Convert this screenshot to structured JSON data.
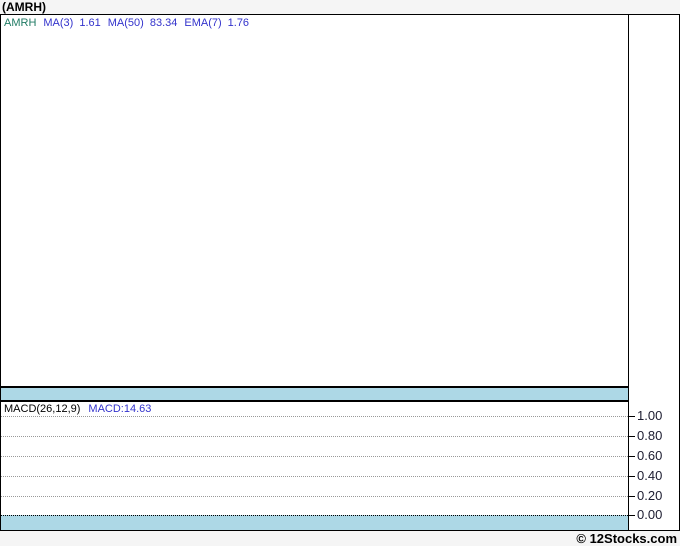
{
  "page": {
    "title": "(AMRH)",
    "copyright": "© 12Stocks.com"
  },
  "indicators": {
    "symbol": "AMRH",
    "items": [
      {
        "label": "MA(3)",
        "value": "1.61"
      },
      {
        "label": "MA(50)",
        "value": "83.34"
      },
      {
        "label": "EMA(7)",
        "value": "1.76"
      }
    ]
  },
  "macd": {
    "label": "MACD(26,12,9)",
    "value": "MACD:14.63",
    "axis_ticks": [
      "1.00",
      "0.80",
      "0.60",
      "0.40",
      "0.20",
      "0.00"
    ]
  },
  "colors": {
    "symbol": "#1f7a63",
    "blue": "#3333cc",
    "band": "#add8e6",
    "grid": "#999999",
    "axis_text": "#1c1c30"
  },
  "chart_data": {
    "type": "line",
    "title": "(AMRH)",
    "panels": [
      {
        "name": "price",
        "legend": [
          "AMRH",
          "MA(3) 1.61",
          "MA(50) 83.34",
          "EMA(7) 1.76"
        ],
        "legend_position": "top-left",
        "grid": false,
        "series": [],
        "note": "price panel rendered empty - no visible data points"
      },
      {
        "name": "MACD",
        "legend": [
          "MACD(26,12,9)",
          "MACD:14.63"
        ],
        "legend_position": "top-left",
        "ylim": [
          0.0,
          1.0
        ],
        "yticks": [
          1.0,
          0.8,
          0.6,
          0.4,
          0.2,
          0.0
        ],
        "yaxis_position": "right",
        "grid": true,
        "series": [],
        "note": "MACD panel rendered empty - no visible data points"
      }
    ]
  }
}
